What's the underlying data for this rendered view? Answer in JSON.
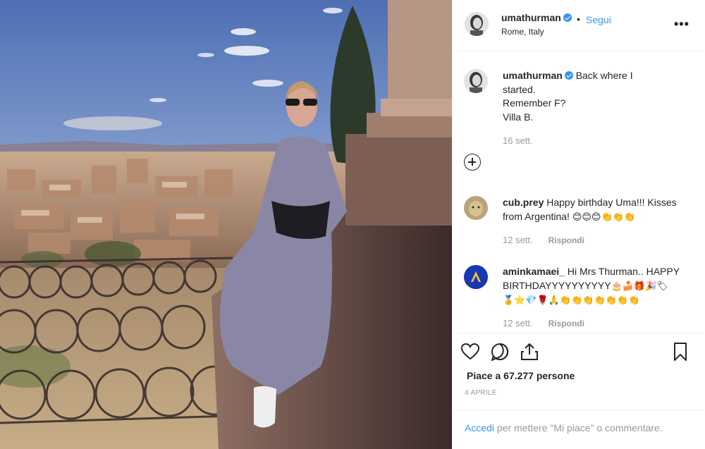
{
  "post": {
    "username": "umathurman",
    "follow_label": "Segui",
    "dot": "•",
    "location": "Rome, Italy",
    "more_label": "•••"
  },
  "caption": {
    "username": "umathurman",
    "line1": "Back where I",
    "line2": "started.",
    "line3": "Remember F?",
    "line4": "Villa B.",
    "time": "16 sett."
  },
  "comments": [
    {
      "username": "cub.prey",
      "text": "Happy birthday Uma!!! Kisses",
      "text2": "from Argentina!",
      "emojis": "😊😊😊👏👏👏",
      "time": "12 sett.",
      "reply_label": "Rispondi"
    },
    {
      "username": "aminkamaei_",
      "text": "Hi Mrs Thurman.. HAPPY",
      "text2": "BIRTHDAYYYYYYYYYY",
      "emojis": "🎂🍰🎁🎉🏷",
      "emojis2": "🏅⭐💎🌹🙏👏👏👏👏👏👏👏",
      "time": "12 sett.",
      "reply_label": "Rispondi"
    }
  ],
  "likes": {
    "text": "Piace a 67.277 persone"
  },
  "date": "4 APRILE",
  "login": {
    "link": "Accedi",
    "rest": "per mettere \"Mi piace\" o commentare."
  },
  "icons": {
    "like": "heart-icon",
    "comment": "comment-icon",
    "share": "share-icon",
    "save": "bookmark-icon",
    "add": "add-comment-icon",
    "verified": "verified-badge-icon",
    "more": "more-options-icon"
  },
  "colors": {
    "accent": "#3897f0",
    "text": "#262626",
    "muted": "#999999",
    "border": "#efefef"
  }
}
